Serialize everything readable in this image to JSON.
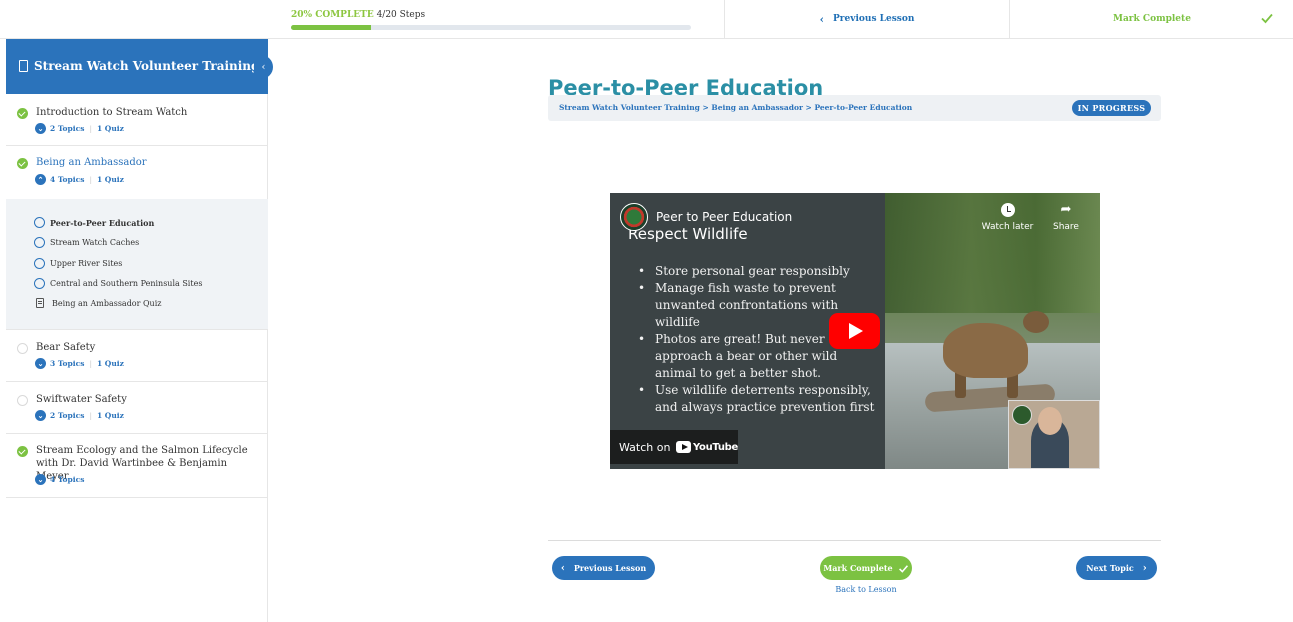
{
  "progress": {
    "percent_label": "20% COMPLETE",
    "steps_label": "4/20 Steps",
    "fraction": 0.2
  },
  "top_nav": {
    "previous_label": "Previous Lesson",
    "mark_complete_label": "Mark Complete"
  },
  "sidebar": {
    "course_title": "Stream Watch Volunteer Training",
    "lessons": [
      {
        "title": "Introduction to Stream Watch",
        "status": "complete",
        "topics": "2 Topics",
        "quiz": "1 Quiz"
      },
      {
        "title": "Being an Ambassador",
        "status": "complete",
        "topics": "4 Topics",
        "quiz": "1 Quiz"
      },
      {
        "title": "Bear Safety",
        "status": "incomplete",
        "topics": "3 Topics",
        "quiz": "1 Quiz"
      },
      {
        "title": "Swiftwater Safety",
        "status": "incomplete",
        "topics": "2 Topics",
        "quiz": "1 Quiz"
      },
      {
        "title": "Stream Ecology and the Salmon Lifecycle with Dr. David Wartinbee & Benjamin Meyer",
        "status": "complete",
        "topics": "4 Topics"
      }
    ],
    "topics": [
      {
        "title": "Peer-to-Peer Education"
      },
      {
        "title": "Stream Watch Caches"
      },
      {
        "title": "Upper River Sites"
      },
      {
        "title": "Central and Southern Peninsula Sites"
      },
      {
        "title": "Being an Ambassador Quiz"
      }
    ]
  },
  "main": {
    "title": "Peer-to-Peer Education",
    "breadcrumb": "Stream Watch Volunteer Training > Being an Ambassador > Peer-to-Peer Education",
    "status_badge": "IN PROGRESS"
  },
  "video": {
    "title": "Peer to Peer Education",
    "slide_heading": "Respect Wildlife",
    "bullets": [
      "Store personal gear responsibly",
      "Manage fish waste to prevent unwanted confrontations with wildlife",
      "Photos are great! But never approach a bear or other wild animal to get a better shot.",
      "Use wildlife deterrents responsibly, and always practice prevention first"
    ],
    "watch_later": "Watch later",
    "share": "Share",
    "watch_on": "Watch on",
    "youtube": "YouTube"
  },
  "bottom_nav": {
    "previous_label": "Previous Lesson",
    "mark_complete_label": "Mark Complete",
    "back_label": "Back to Lesson",
    "next_label": "Next Topic"
  },
  "colors": {
    "primary": "#2b73bb",
    "success": "#7cc242",
    "title": "#2b8fa5"
  }
}
